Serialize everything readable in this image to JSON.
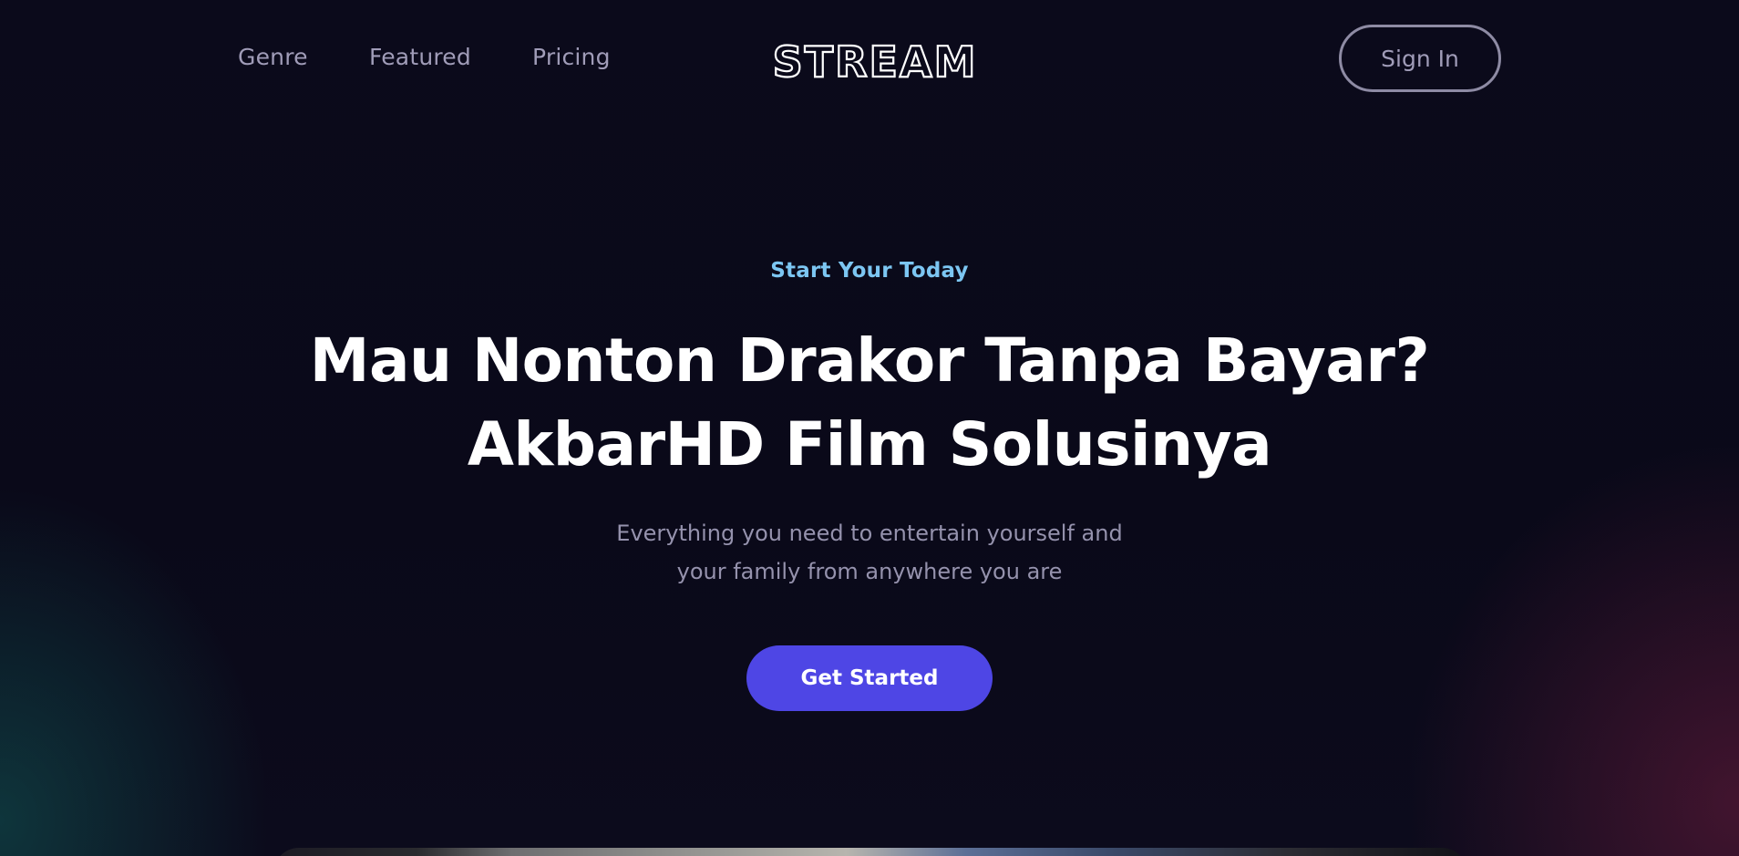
{
  "nav": {
    "links": [
      "Genre",
      "Featured",
      "Pricing"
    ],
    "logo_text": "STREAM",
    "signin_label": "Sign In"
  },
  "hero": {
    "eyebrow": "Start Your Today",
    "headline_lines": [
      "Mau Nonton Drakor Tanpa Bayar?",
      "AkbarHD Film Solusinya"
    ],
    "subtext_lines": [
      "Everything you need to entertain yourself and",
      "your family from anywhere you are"
    ],
    "cta_label": "Get Started"
  },
  "colors": {
    "background": "#0b0a1a",
    "accent": "#4e46e5",
    "eyebrow": "#7cc6f2",
    "muted_text": "#a09cb8"
  }
}
